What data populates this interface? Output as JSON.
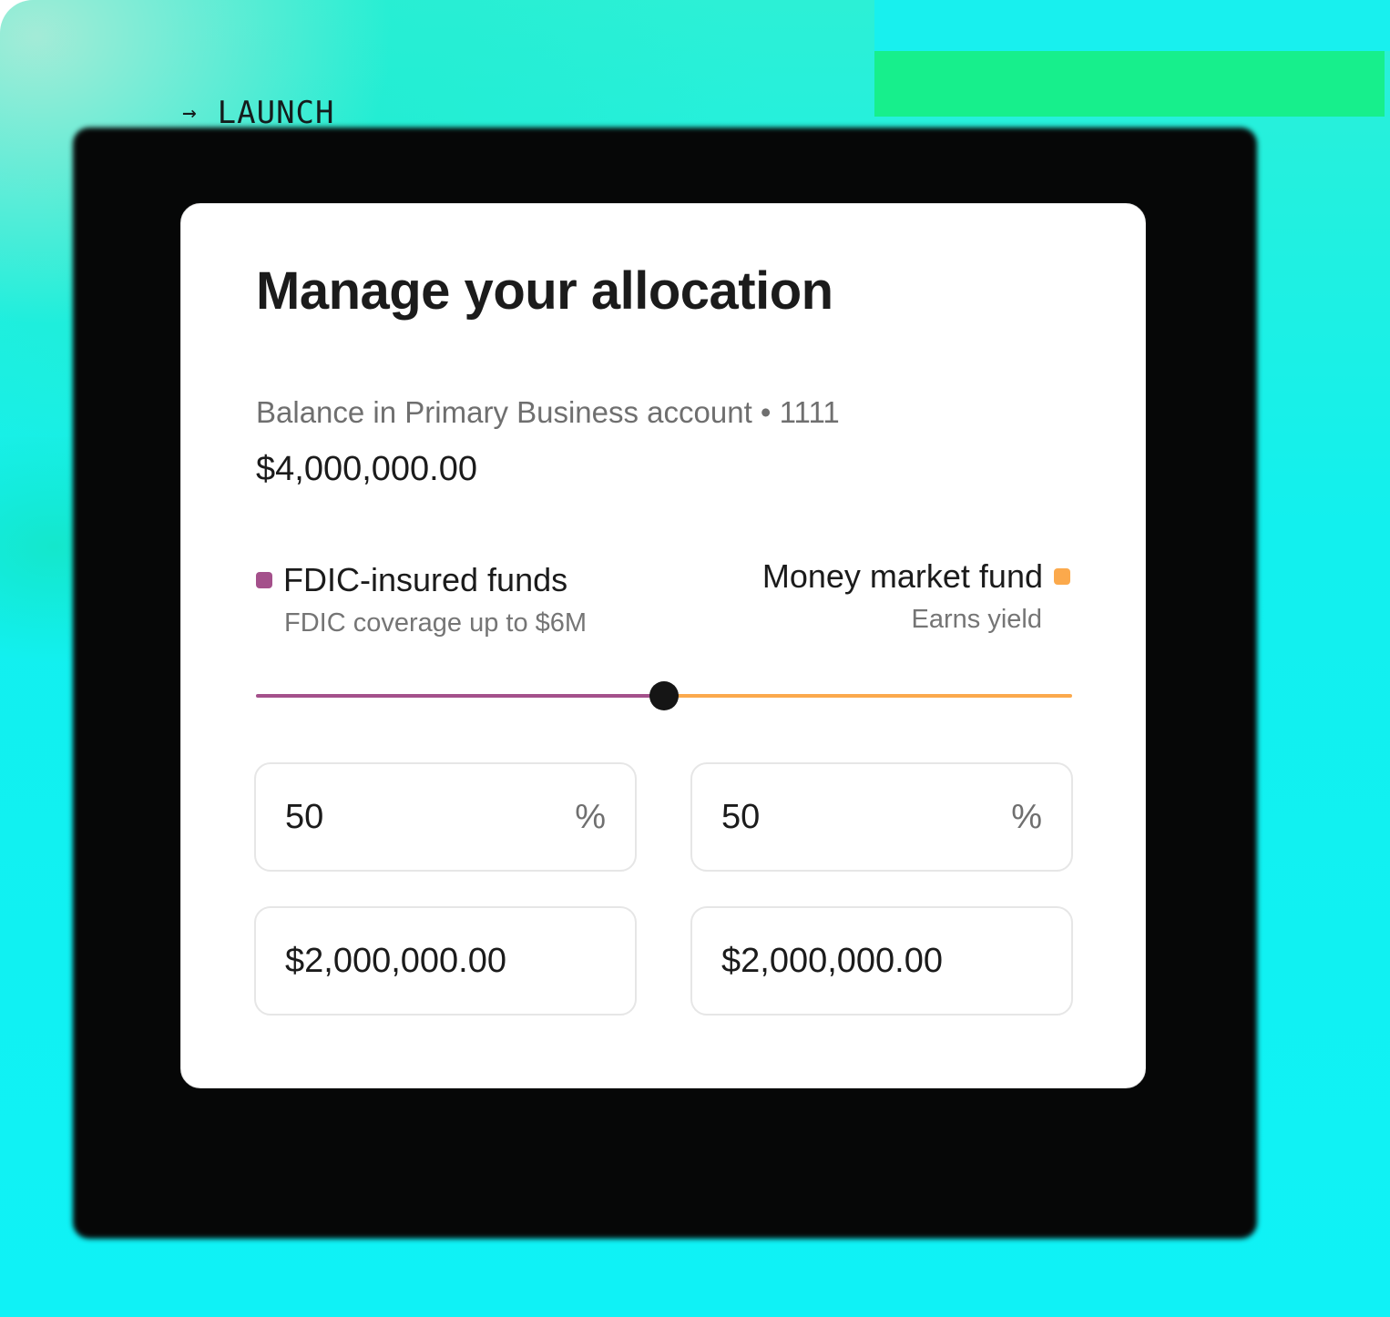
{
  "launch": {
    "arrow": "→",
    "label": "LAUNCH"
  },
  "card": {
    "title": "Manage your allocation",
    "balance_label": "Balance in Primary Business account • 1111",
    "balance_value": "$4,000,000.00"
  },
  "allocation": {
    "left": {
      "title": "FDIC-insured funds",
      "subtitle": "FDIC coverage up to $6M",
      "color": "#a4508b"
    },
    "right": {
      "title": "Money market fund",
      "subtitle": "Earns yield",
      "color": "#fba94c"
    },
    "slider_percent": 50
  },
  "inputs": {
    "left_percent": "50",
    "right_percent": "50",
    "percent_unit": "%",
    "left_amount": "$2,000,000.00",
    "right_amount": "$2,000,000.00"
  },
  "colors": {
    "background_teal": "#12f0ee",
    "thumb": "#151515"
  }
}
